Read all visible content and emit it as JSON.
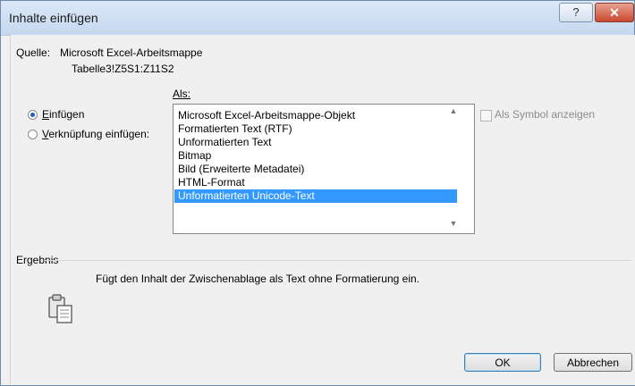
{
  "window": {
    "title": "Inhalte einfügen",
    "help_label": "?",
    "close_label": "✕"
  },
  "source": {
    "label": "Quelle:",
    "value": "Microsoft Excel-Arbeitsmappe",
    "range": "Tabelle3!Z5S1:Z11S2"
  },
  "as_label": "Als:",
  "options": [
    {
      "label": "Einfügen",
      "selected": true
    },
    {
      "label": "Verknüpfung einfügen:",
      "selected": false
    }
  ],
  "formats": [
    "Microsoft Excel-Arbeitsmappe-Objekt",
    "Formatierten Text (RTF)",
    "Unformatierten Text",
    "Bitmap",
    "Bild (Erweiterte Metadatei)",
    "HTML-Format",
    "Unformatierten Unicode-Text"
  ],
  "selected_format_index": 6,
  "display_as_icon": {
    "label": "Als Symbol anzeigen",
    "checked": false,
    "enabled": false
  },
  "result": {
    "label": "Ergebnis",
    "text": "Fügt den Inhalt der Zwischenablage als Text ohne Formatierung ein.",
    "icon": "clipboard-icon"
  },
  "buttons": {
    "ok": "OK",
    "cancel": "Abbrechen"
  },
  "colors": {
    "selection": "#3399ff",
    "close_button": "#c9482f",
    "title_bar": "#dbe8f7"
  }
}
